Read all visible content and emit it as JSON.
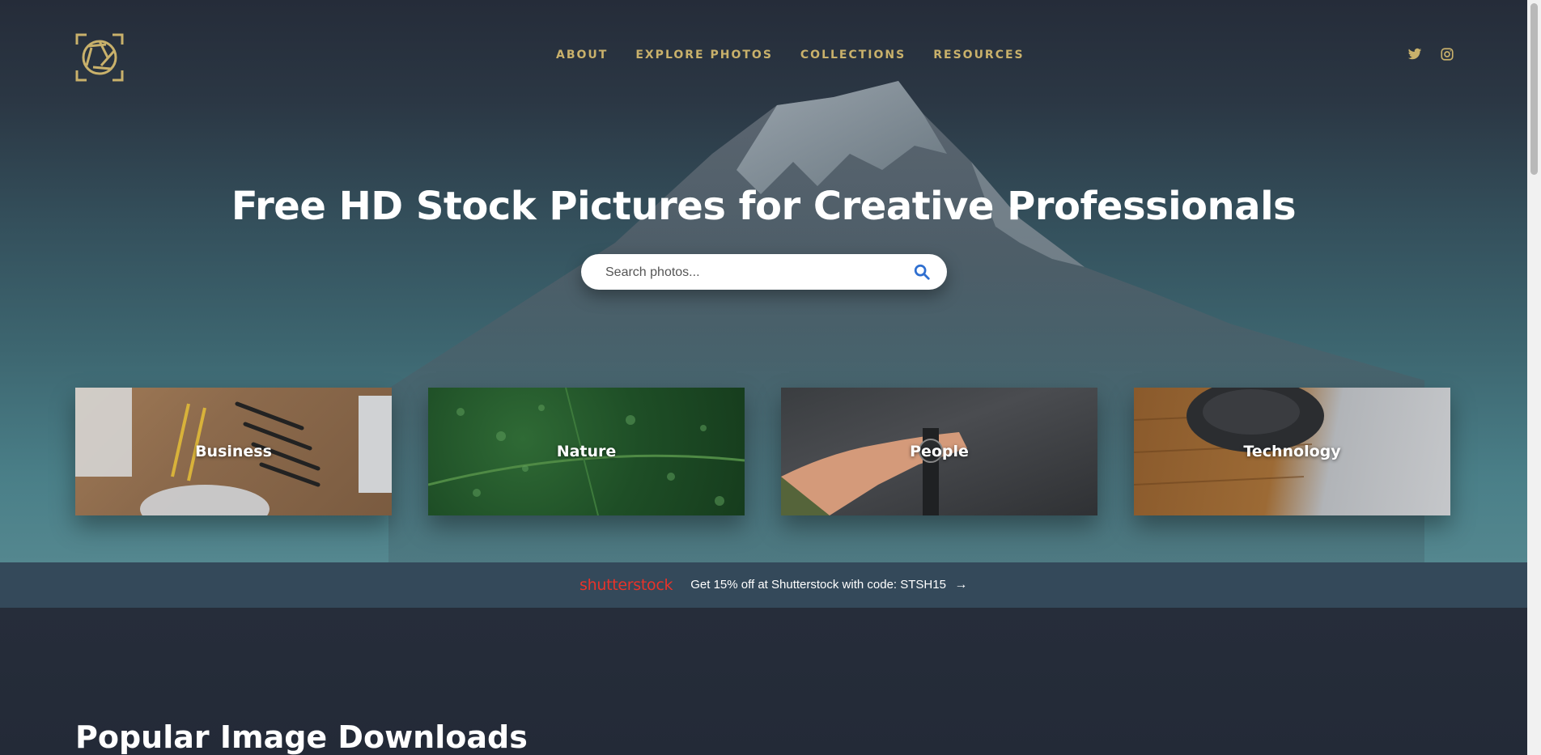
{
  "nav": {
    "logo_icon": "aperture-icon",
    "items": [
      {
        "label": "ABOUT"
      },
      {
        "label": "EXPLORE PHOTOS"
      },
      {
        "label": "COLLECTIONS"
      },
      {
        "label": "RESOURCES"
      }
    ],
    "social": [
      "twitter-icon",
      "instagram-icon"
    ]
  },
  "hero": {
    "title": "Free HD Stock Pictures for Creative Professionals",
    "search": {
      "placeholder": "Search photos...",
      "value": ""
    }
  },
  "categories": [
    {
      "label": "Business"
    },
    {
      "label": "Nature"
    },
    {
      "label": "People"
    },
    {
      "label": "Technology"
    }
  ],
  "promo": {
    "brand": "shutterstock",
    "text": "Get 15% off at Shutterstock with code: STSH15",
    "arrow": "→"
  },
  "section": {
    "title": "Popular Image Downloads"
  },
  "colors": {
    "accent_gold": "#c9b16b",
    "background": "#242b38",
    "promo_bg": "#34495a",
    "brand_red": "#e8332a",
    "search_icon_blue": "#2f6fd0"
  }
}
